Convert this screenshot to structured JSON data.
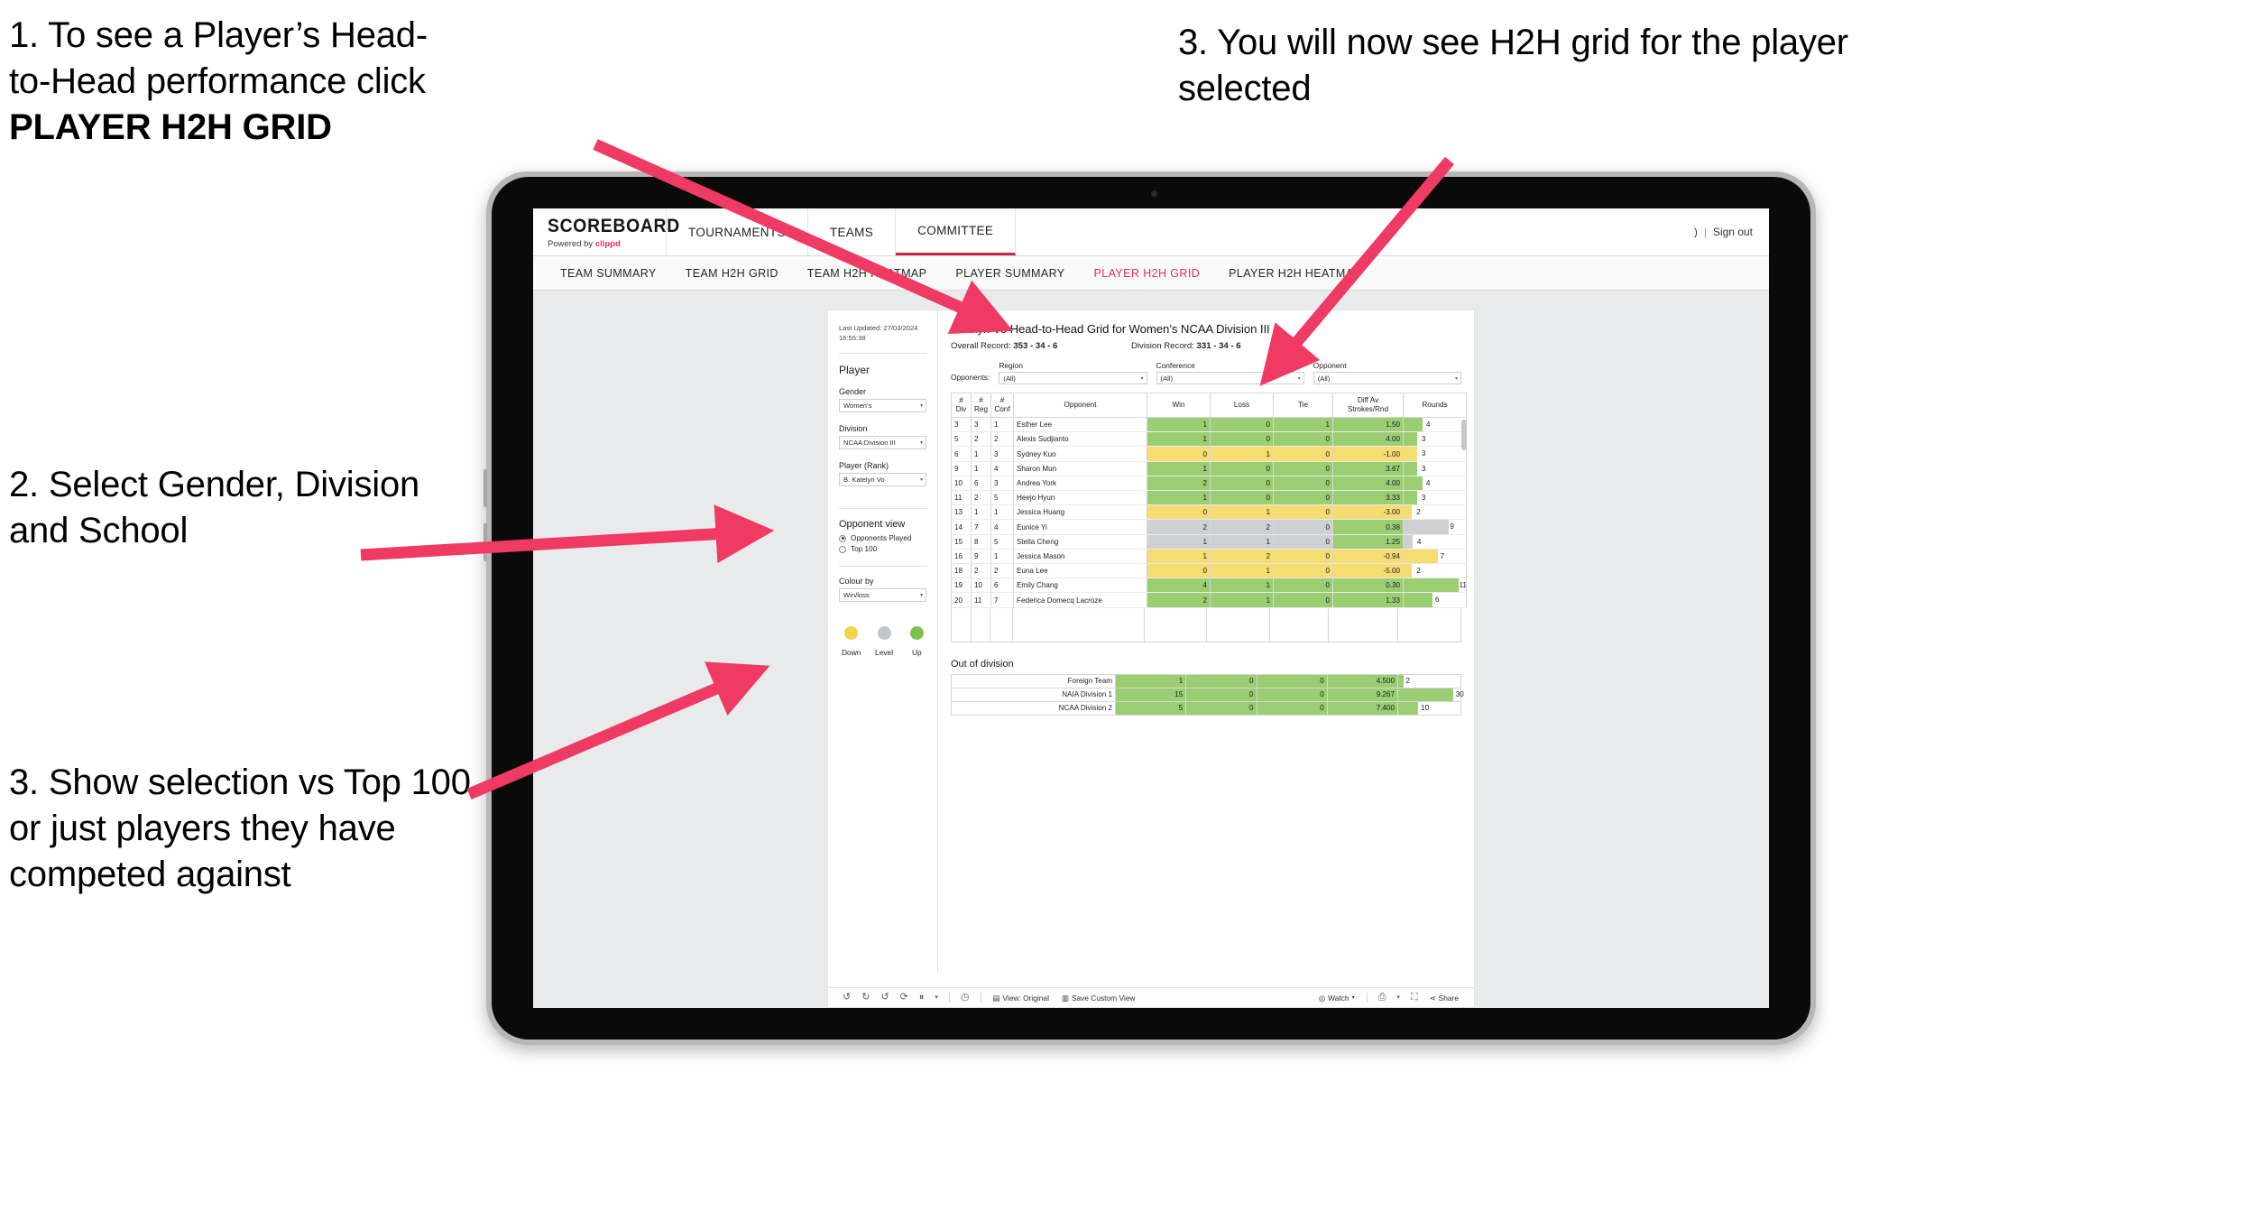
{
  "annotations": {
    "a1_line1": "1. To see a Player’s Head-",
    "a1_line2": "to-Head performance click",
    "a1_bold": "PLAYER H2H GRID",
    "a2": "2. Select Gender, Division and School",
    "a3": "3. Show selection vs Top 100 or just players they have competed against",
    "a4": "3. You will now see H2H grid for the player selected"
  },
  "app": {
    "brand_name": "SCOREBOARD",
    "brand_sub_prefix": "Powered by ",
    "brand_sub_accent": "clippd",
    "top_nav": [
      {
        "label": "TOURNAMENTS",
        "active": false
      },
      {
        "label": "TEAMS",
        "active": false
      },
      {
        "label": "COMMITTEE",
        "active": true
      }
    ],
    "header_right": {
      "user_glyph": ")",
      "separator": "|",
      "sign_out": "Sign out"
    },
    "sub_nav": [
      {
        "label": "TEAM SUMMARY",
        "active": false
      },
      {
        "label": "TEAM H2H GRID",
        "active": false
      },
      {
        "label": "TEAM H2H HEATMAP",
        "active": false
      },
      {
        "label": "PLAYER SUMMARY",
        "active": false
      },
      {
        "label": "PLAYER H2H GRID",
        "active": true
      },
      {
        "label": "PLAYER H2H HEATMAP",
        "active": false
      }
    ],
    "accent_pink": "#ec2b56",
    "accent_red": "#c42a47"
  },
  "rail": {
    "last_updated": "Last Updated: 27/03/2024 16:55:38",
    "player_heading": "Player",
    "filters": [
      {
        "label": "Gender",
        "value": "Women’s"
      },
      {
        "label": "Division",
        "value": "NCAA Division III"
      },
      {
        "label": "Player (Rank)",
        "value": "B. Katelyn Vo"
      }
    ],
    "opponent_view_heading": "Opponent view",
    "opponent_view_options": [
      {
        "label": "Opponents Played",
        "selected": true
      },
      {
        "label": "Top 100",
        "selected": false
      }
    ],
    "colour_by_label": "Colour by",
    "colour_by_value": "Win/loss",
    "legend": [
      {
        "label": "Down",
        "color": "#f2d44b"
      },
      {
        "label": "Level",
        "color": "#c3c6c9"
      },
      {
        "label": "Up",
        "color": "#7cc250"
      }
    ]
  },
  "viz": {
    "title": "Katelyn Vo Head-to-Head Grid for Women’s NCAA Division III",
    "overall_record_label": "Overall Record:",
    "overall_record_value": "353 -  34 - 6",
    "division_record_label": "Division Record:",
    "division_record_value": "331 -  34 - 6",
    "opponents_label": "Opponents:",
    "opponent_filters": [
      {
        "label": "Region",
        "value": "(All)"
      },
      {
        "label": "Conference",
        "value": "(All)"
      },
      {
        "label": "Opponent",
        "value": "(All)"
      }
    ],
    "out_of_division_heading": "Out of division"
  },
  "chart_data": {
    "type": "table",
    "title": "Katelyn Vo Head-to-Head Grid for Women’s NCAA Division III",
    "columns": [
      "# Div",
      "# Reg",
      "# Conf",
      "Opponent",
      "Win",
      "Loss",
      "Tie",
      "Diff Av Strokes/Rnd",
      "Rounds"
    ],
    "column_headers_2line": [
      {
        "l1": "#",
        "l2": "Div"
      },
      {
        "l1": "#",
        "l2": "Reg"
      },
      {
        "l1": "#",
        "l2": "Conf"
      },
      {
        "l1": "Opponent",
        "l2": ""
      },
      {
        "l1": "Win",
        "l2": ""
      },
      {
        "l1": "Loss",
        "l2": ""
      },
      {
        "l1": "Tie",
        "l2": ""
      },
      {
        "l1": "Diff Av",
        "l2": "Strokes/Rnd"
      },
      {
        "l1": "Rounds",
        "l2": ""
      }
    ],
    "rows": [
      {
        "div": "3",
        "reg": "3",
        "conf": "1",
        "opponent": "Esther Lee",
        "win": "1",
        "loss": "0",
        "tie": "1",
        "diff": "1.50",
        "rounds": "4",
        "rounds_pct": 30,
        "state": "up"
      },
      {
        "div": "5",
        "reg": "2",
        "conf": "2",
        "opponent": "Alexis Sudjianto",
        "win": "1",
        "loss": "0",
        "tie": "0",
        "diff": "4.00",
        "rounds": "3",
        "rounds_pct": 22,
        "state": "up"
      },
      {
        "div": "6",
        "reg": "1",
        "conf": "3",
        "opponent": "Sydney Kuo",
        "win": "0",
        "loss": "1",
        "tie": "0",
        "diff": "-1.00",
        "rounds": "3",
        "rounds_pct": 22,
        "state": "down"
      },
      {
        "div": "9",
        "reg": "1",
        "conf": "4",
        "opponent": "Sharon Mun",
        "win": "1",
        "loss": "0",
        "tie": "0",
        "diff": "3.67",
        "rounds": "3",
        "rounds_pct": 22,
        "state": "up"
      },
      {
        "div": "10",
        "reg": "6",
        "conf": "3",
        "opponent": "Andrea York",
        "win": "2",
        "loss": "0",
        "tie": "0",
        "diff": "4.00",
        "rounds": "4",
        "rounds_pct": 30,
        "state": "up"
      },
      {
        "div": "11",
        "reg": "2",
        "conf": "5",
        "opponent": "Heejo Hyun",
        "win": "1",
        "loss": "0",
        "tie": "0",
        "diff": "3.33",
        "rounds": "3",
        "rounds_pct": 22,
        "state": "up"
      },
      {
        "div": "13",
        "reg": "1",
        "conf": "1",
        "opponent": "Jessica Huang",
        "win": "0",
        "loss": "1",
        "tie": "0",
        "diff": "-3.00",
        "rounds": "2",
        "rounds_pct": 13,
        "state": "down"
      },
      {
        "div": "14",
        "reg": "7",
        "conf": "4",
        "opponent": "Eunice Yi",
        "win": "2",
        "loss": "2",
        "tie": "0",
        "diff": "0.38",
        "rounds": "9",
        "rounds_pct": 72,
        "state": "level",
        "diff_state": "up"
      },
      {
        "div": "15",
        "reg": "8",
        "conf": "5",
        "opponent": "Stella Cheng",
        "win": "1",
        "loss": "1",
        "tie": "0",
        "diff": "1.25",
        "rounds": "4",
        "rounds_pct": 14,
        "state": "level",
        "diff_state": "up"
      },
      {
        "div": "16",
        "reg": "9",
        "conf": "1",
        "opponent": "Jessica Mason",
        "win": "1",
        "loss": "2",
        "tie": "0",
        "diff": "-0.94",
        "rounds": "7",
        "rounds_pct": 55,
        "state": "down"
      },
      {
        "div": "18",
        "reg": "2",
        "conf": "2",
        "opponent": "Euna Lee",
        "win": "0",
        "loss": "1",
        "tie": "0",
        "diff": "-5.00",
        "rounds": "2",
        "rounds_pct": 13,
        "state": "down"
      },
      {
        "div": "19",
        "reg": "10",
        "conf": "6",
        "opponent": "Emily Chang",
        "win": "4",
        "loss": "1",
        "tie": "0",
        "diff": "0.30",
        "rounds": "11",
        "rounds_pct": 88,
        "state": "up"
      },
      {
        "div": "20",
        "reg": "11",
        "conf": "7",
        "opponent": "Federica Domecq Lacroze",
        "win": "2",
        "loss": "1",
        "tie": "0",
        "diff": "1.33",
        "rounds": "6",
        "rounds_pct": 46,
        "state": "up"
      }
    ],
    "out_of_division": {
      "heading": "Out of division",
      "rows": [
        {
          "label": "Foreign Team",
          "win": "1",
          "loss": "0",
          "tie": "0",
          "diff": "4.500",
          "rounds": "2",
          "rounds_pct": 8,
          "state": "up"
        },
        {
          "label": "NAIA Division 1",
          "win": "15",
          "loss": "0",
          "tie": "0",
          "diff": "9.267",
          "rounds": "30",
          "rounds_pct": 88,
          "state": "up"
        },
        {
          "label": "NCAA Division 2",
          "win": "5",
          "loss": "0",
          "tie": "0",
          "diff": "7.400",
          "rounds": "10",
          "rounds_pct": 32,
          "state": "up"
        }
      ]
    },
    "colors": {
      "up": "#9bcd72",
      "down": "#f5dd72",
      "level": "#cfd0d2"
    }
  },
  "toolbar": {
    "icons": [
      "undo-icon",
      "redo-icon",
      "revert-icon",
      "refresh-data-icon",
      "pause-icon",
      "zoom-icon"
    ],
    "buttons": [
      {
        "label": "View: Original",
        "icon": "view-icon"
      },
      {
        "label": "Save Custom View",
        "icon": "save-view-icon"
      },
      {
        "label": "Watch",
        "icon": "watch-icon",
        "caret": true
      },
      {
        "label": "Share",
        "icon": "share-icon"
      }
    ]
  }
}
